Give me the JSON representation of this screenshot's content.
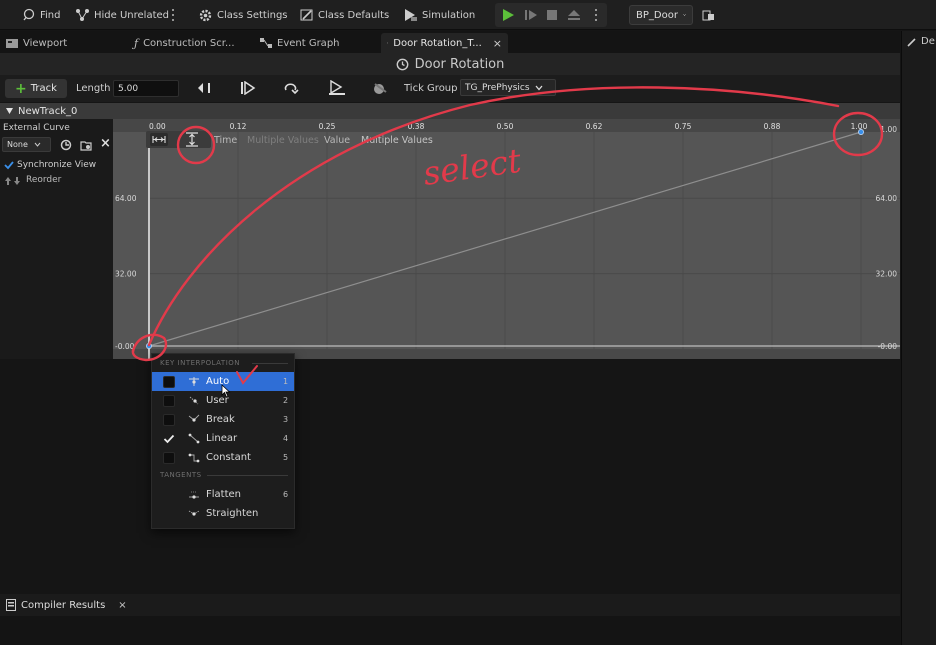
{
  "toolbar": {
    "find_label": "Find",
    "hide_unrelated_label": "Hide Unrelated",
    "class_settings_label": "Class Settings",
    "class_defaults_label": "Class Defaults",
    "simulation_label": "Simulation",
    "debug_object": "BP_Door"
  },
  "tabs": [
    {
      "label": "Viewport",
      "icon": "viewport-icon"
    },
    {
      "label": "Construction Scr...",
      "icon": "function-icon"
    },
    {
      "label": "Event Graph",
      "icon": "graph-icon"
    },
    {
      "label": "Door Rotation_T...",
      "icon": "timeline-icon",
      "active": true
    }
  ],
  "right_strip_label": "De",
  "timeline": {
    "title": "Door Rotation",
    "add_track_label": "Track",
    "length_label": "Length",
    "length_value": "5.00",
    "tick_group_label": "Tick Group",
    "tick_group_value": "TG_PrePhysics",
    "track_name": "NewTrack_0"
  },
  "left_panel": {
    "external_curve_label": "External Curve",
    "curve_value": "None",
    "sync_view_label": "Synchronize View",
    "sync_view_checked": true,
    "reorder_label": "Reorder"
  },
  "graph": {
    "x_ticks": [
      "0.00",
      "0.12",
      "0.25",
      "0.38",
      "0.50",
      "0.62",
      "0.75",
      "0.88",
      "1.00"
    ],
    "y_ticks_left": [
      "64.00",
      "32.00",
      "-0.00"
    ],
    "y_ticks_right": [
      "1.00",
      "64.00",
      "32.00",
      "-0.00"
    ],
    "time_label": "Time",
    "time_value": "Multiple Values",
    "value_label": "Value",
    "value_value": "Multiple Values",
    "curve_keys": [
      {
        "time": 0.0,
        "value": 0.0
      },
      {
        "time": 1.0,
        "value": 90.0
      }
    ],
    "annotation_text": "select",
    "annotation_color": "#e23a4a",
    "annotation_check": "V"
  },
  "context_menu": {
    "section_interp": "KEY INTERPOLATION",
    "section_tangents": "TANGENTS",
    "items": [
      {
        "label": "Auto",
        "key": "1",
        "checked": false,
        "highlighted": true,
        "icon": "auto-tangent-icon"
      },
      {
        "label": "User",
        "key": "2",
        "checked": false,
        "highlighted": false,
        "icon": "user-tangent-icon"
      },
      {
        "label": "Break",
        "key": "3",
        "checked": false,
        "highlighted": false,
        "icon": "break-tangent-icon"
      },
      {
        "label": "Linear",
        "key": "4",
        "checked": true,
        "highlighted": false,
        "icon": "linear-icon"
      },
      {
        "label": "Constant",
        "key": "5",
        "checked": false,
        "highlighted": false,
        "icon": "constant-icon"
      }
    ],
    "tangent_items": [
      {
        "label": "Flatten",
        "key": "6",
        "icon": "flatten-icon"
      },
      {
        "label": "Straighten",
        "key": "",
        "icon": "straighten-icon"
      }
    ]
  },
  "bottom": {
    "compiler_results_label": "Compiler Results"
  },
  "colors": {
    "accent": "#2f6ed6",
    "play_green": "#5cbf3a",
    "graph_bg": "#555555",
    "annotation_red": "#e23a4a"
  }
}
